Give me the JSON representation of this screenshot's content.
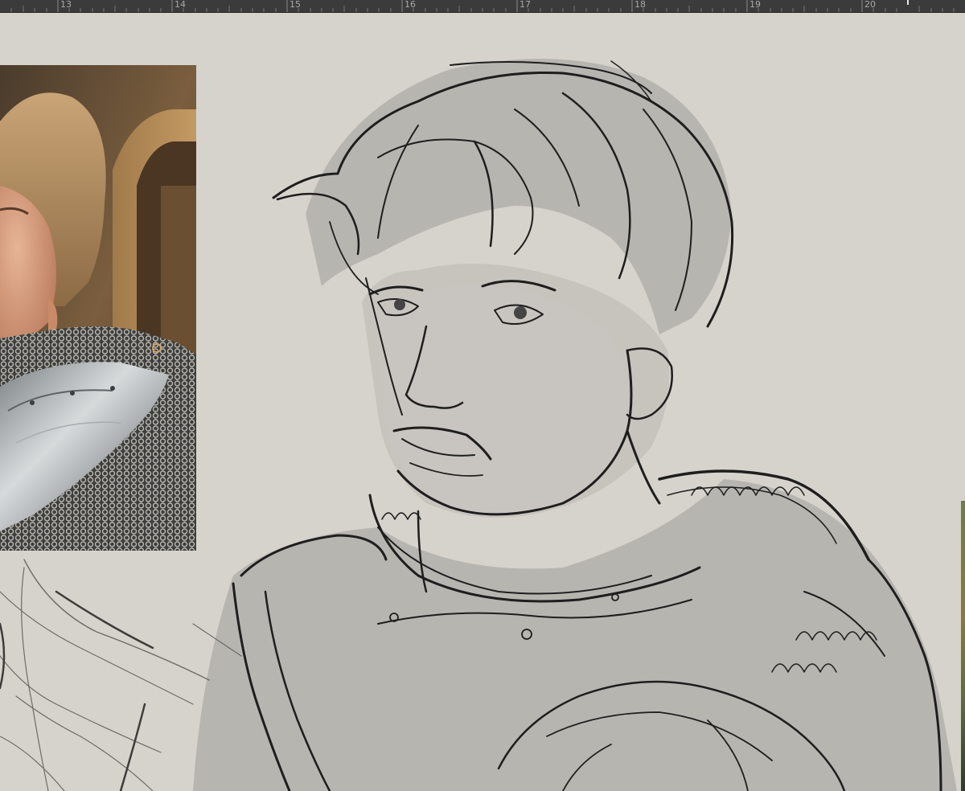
{
  "ruler": {
    "labels": [
      {
        "text": "13",
        "pos": 0
      },
      {
        "text": "14",
        "pos": 1
      },
      {
        "text": "15",
        "pos": 2
      },
      {
        "text": "16",
        "pos": 3
      },
      {
        "text": "17",
        "pos": 4
      },
      {
        "text": "18",
        "pos": 5
      },
      {
        "text": "19",
        "pos": 6
      },
      {
        "text": "20",
        "pos": 7
      }
    ]
  },
  "colors": {
    "canvas_bg": "#d6d3cc",
    "ruler_bg": "#3b3b3b",
    "ruler_text": "#a9a9a9"
  }
}
